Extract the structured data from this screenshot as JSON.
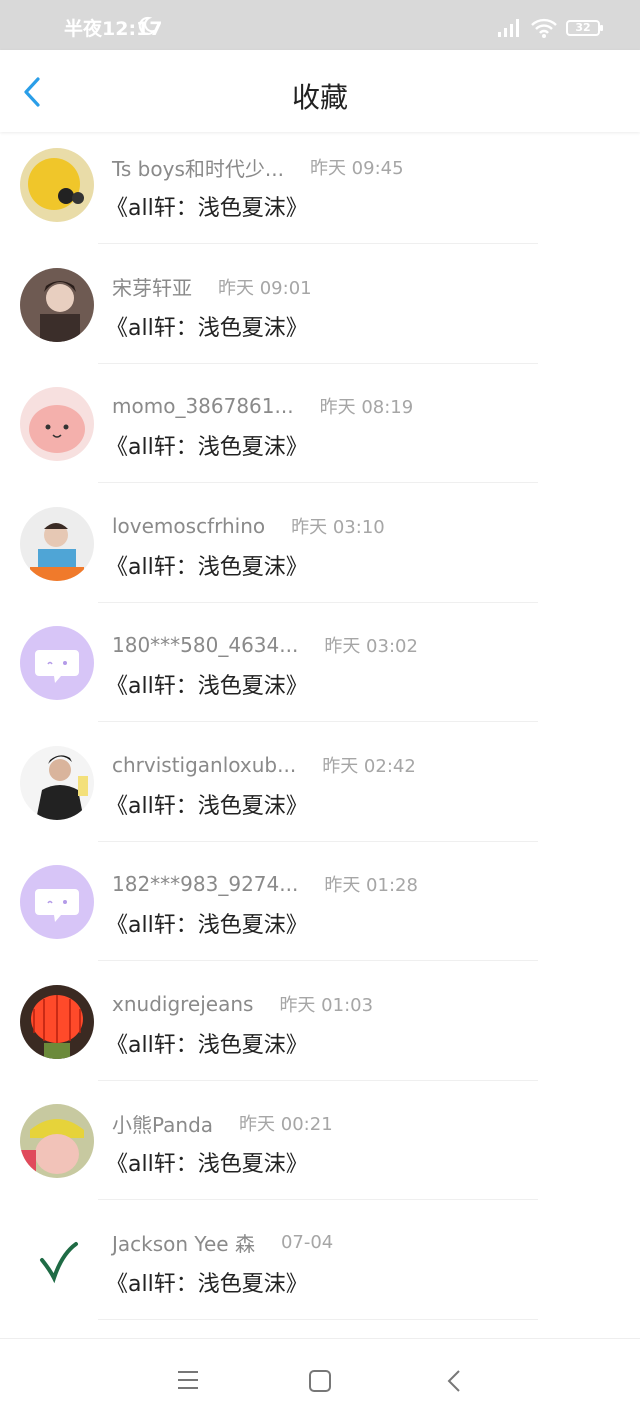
{
  "status_bar": {
    "time": "半夜12:17",
    "battery": "32"
  },
  "header": {
    "title": "收藏"
  },
  "items": [
    {
      "name": "Ts boys和时代少...",
      "time": "昨天 09:45",
      "message": "《all轩：浅色夏沫》"
    },
    {
      "name": "宋芽轩亚",
      "time": "昨天 09:01",
      "message": "《all轩：浅色夏沫》"
    },
    {
      "name": "momo_3867861...",
      "time": "昨天 08:19",
      "message": "《all轩：浅色夏沫》"
    },
    {
      "name": "lovemoscfrhino",
      "time": "昨天 03:10",
      "message": "《all轩：浅色夏沫》"
    },
    {
      "name": "180***580_4634...",
      "time": "昨天 03:02",
      "message": "《all轩：浅色夏沫》"
    },
    {
      "name": "chrvistiganloxub...",
      "time": "昨天 02:42",
      "message": "《all轩：浅色夏沫》"
    },
    {
      "name": "182***983_9274...",
      "time": "昨天 01:28",
      "message": "《all轩：浅色夏沫》"
    },
    {
      "name": "xnudigrejeans",
      "time": "昨天 01:03",
      "message": "《all轩：浅色夏沫》"
    },
    {
      "name": "小熊Panda",
      "time": "昨天 00:21",
      "message": "《all轩：浅色夏沫》"
    },
    {
      "name": "Jackson Yee 森",
      "time": "07-04",
      "message": "《all轩：浅色夏沫》"
    }
  ],
  "bottom_nav": {
    "icons": [
      "menu-icon",
      "home-square-icon",
      "back-triangle-icon"
    ]
  },
  "colors": {
    "accent": "#2a9ee8",
    "statusbar": "#d9d9d9",
    "default_avatar": "#d7c5f7"
  }
}
